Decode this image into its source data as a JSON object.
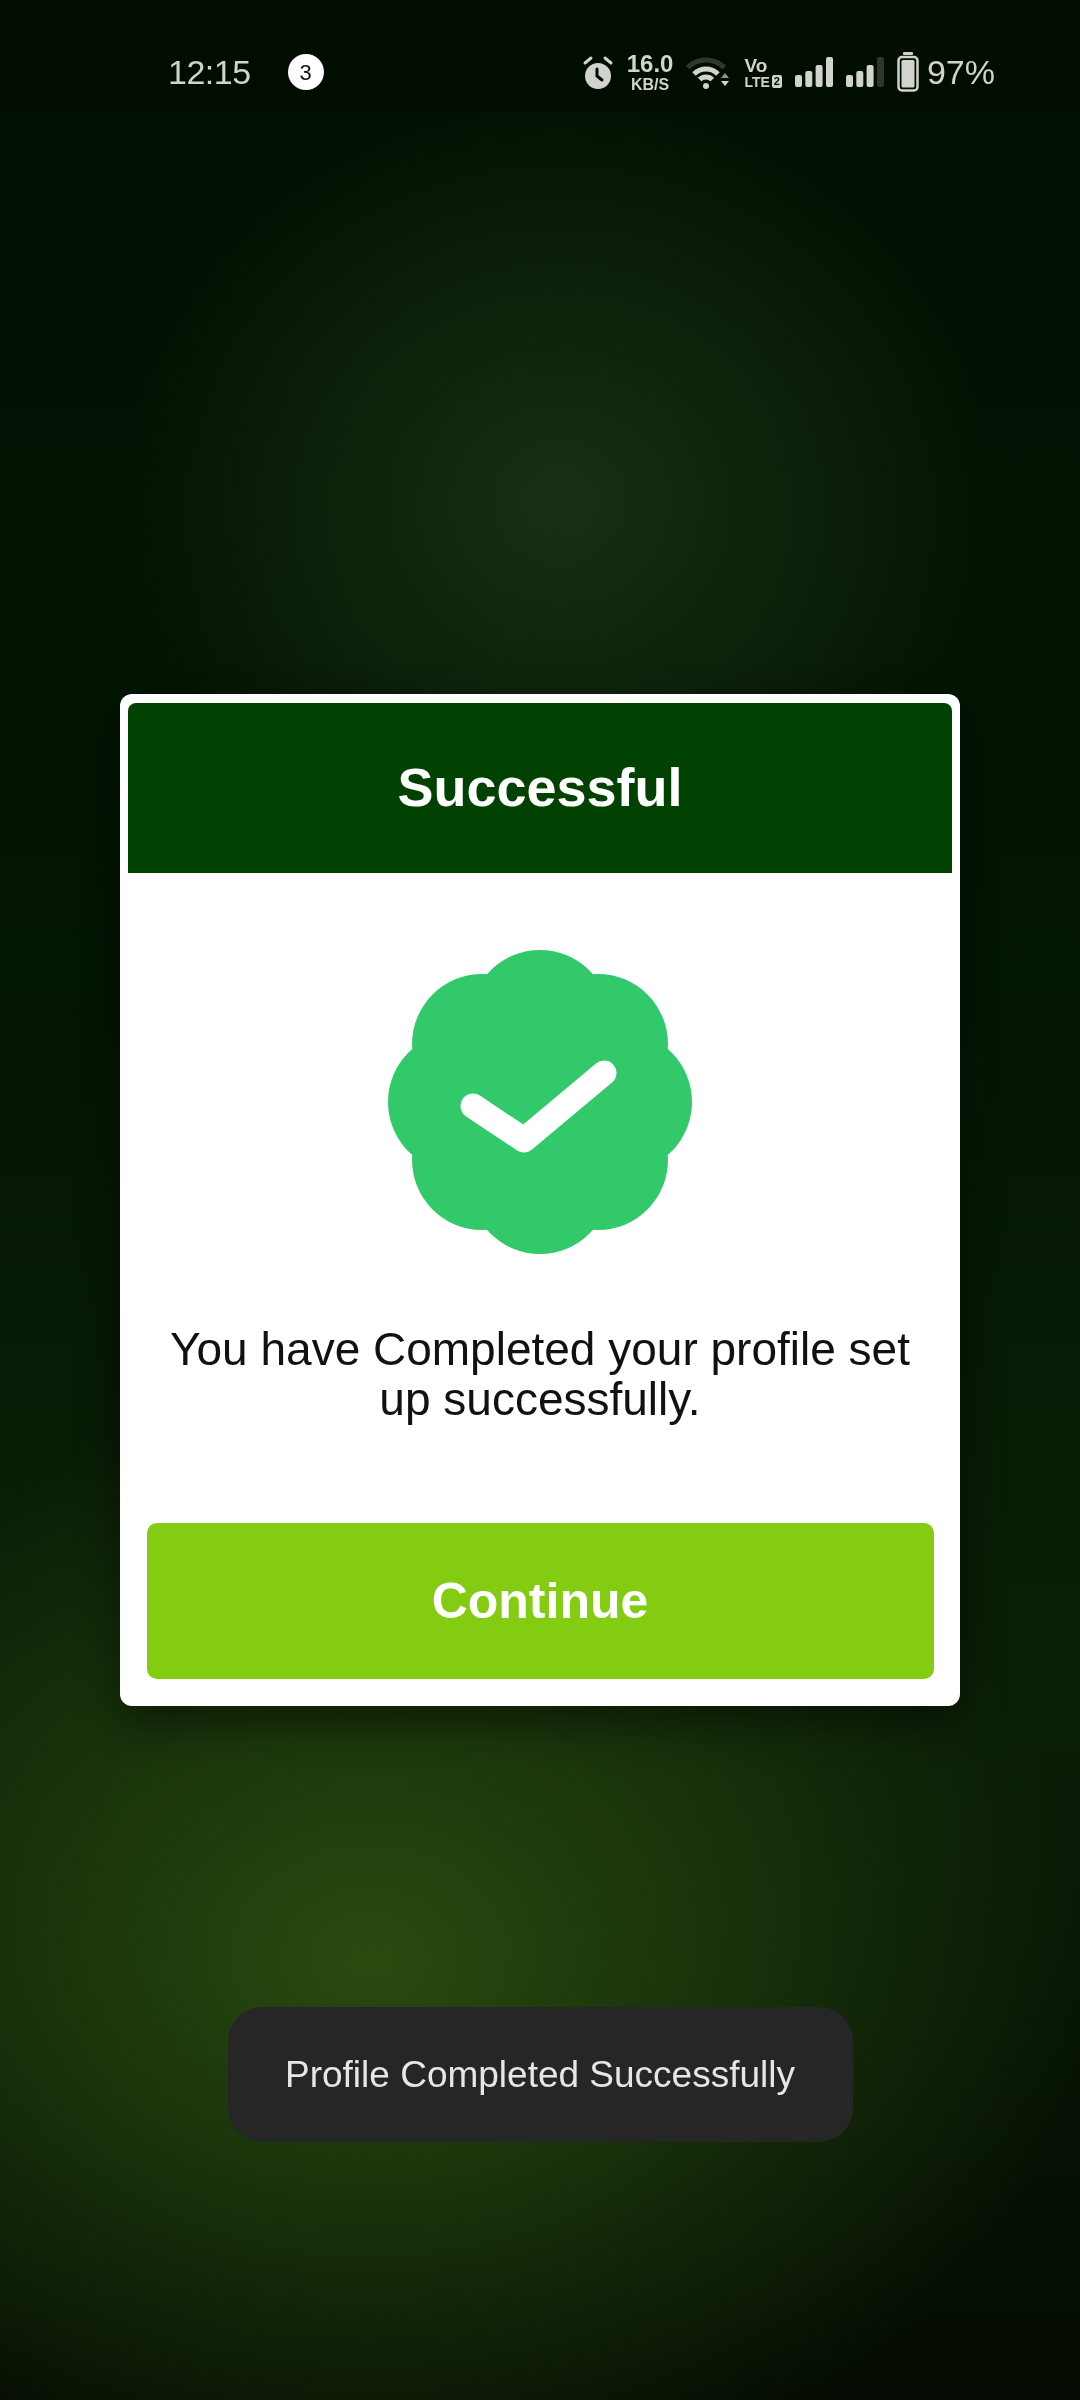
{
  "status_bar": {
    "time": "12:15",
    "notification_count": "3",
    "network_speed": "16.0",
    "network_speed_unit": "KB/S",
    "volte_label": "Vo",
    "lte_label": "LTE",
    "sim_number": "2",
    "battery": "97%"
  },
  "dialog": {
    "title": "Successful",
    "message": "You have Completed your profile set up successfully.",
    "button": "Continue"
  },
  "toast": {
    "text": "Profile Completed Successfully"
  }
}
